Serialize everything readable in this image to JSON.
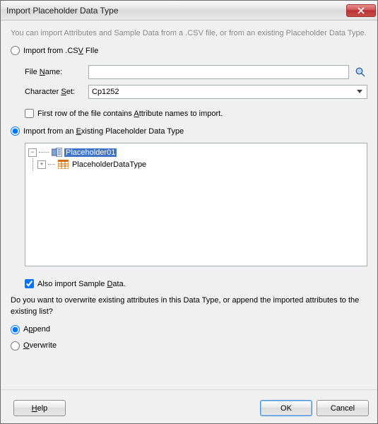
{
  "title": "Import Placeholder Data Type",
  "intro": "You can import Attributes and Sample Data from a .CSV file, or from an existing Placeholder Data Type.",
  "csv_radio_label_pre": "Import from .CS",
  "csv_radio_label_u": "V",
  "csv_radio_label_post": " FIle",
  "file_name_label_pre": "File ",
  "file_name_label_u": "N",
  "file_name_label_post": "ame:",
  "file_name_value": "",
  "charset_label_pre": "Character ",
  "charset_label_u": "S",
  "charset_label_post": "et:",
  "charset_value": "Cp1252",
  "firstrow_label_pre": "First row of the file contains ",
  "firstrow_label_u": "A",
  "firstrow_label_post": "ttribute names to import.",
  "existing_label_pre": "Import from an ",
  "existing_label_u": "E",
  "existing_label_post": "xisting Placeholder Data Type",
  "tree": {
    "root": "Placeholder01",
    "child": "PlaceholderDataType"
  },
  "sample_label_pre": "Also import Sample ",
  "sample_label_u": "D",
  "sample_label_post": "ata.",
  "question_text": "Do you want to overwrite existing attributes in this Data Type, or append the imported attributes to the existing list?",
  "append_label_pre": "A",
  "append_label_u": "p",
  "append_label_post": "pend",
  "overwrite_label_u": "O",
  "overwrite_label_post": "verwrite",
  "buttons": {
    "help_u": "H",
    "help_post": "elp",
    "ok": "OK",
    "cancel": "Cancel"
  }
}
